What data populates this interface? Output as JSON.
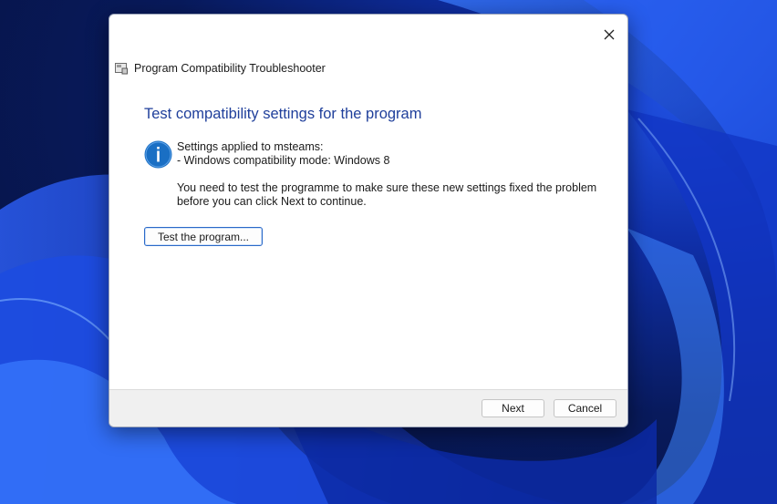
{
  "window": {
    "title": "Program Compatibility Troubleshooter",
    "close_icon": "close-icon",
    "app_icon": "troubleshooter-icon"
  },
  "content": {
    "heading": "Test compatibility settings for the program",
    "info_icon": "info-icon",
    "settings_line1": "Settings applied to msteams:",
    "settings_line2": "- Windows compatibility mode: Windows 8",
    "notice": "You need to test the programme to make sure these new settings fixed the problem before you can click Next to continue.",
    "test_button_label": "Test the program..."
  },
  "footer": {
    "next_label": "Next",
    "cancel_label": "Cancel"
  },
  "colors": {
    "heading": "#1f3f9b",
    "info_icon": "#1a6fc4",
    "test_button_border": "#2a69c8"
  }
}
